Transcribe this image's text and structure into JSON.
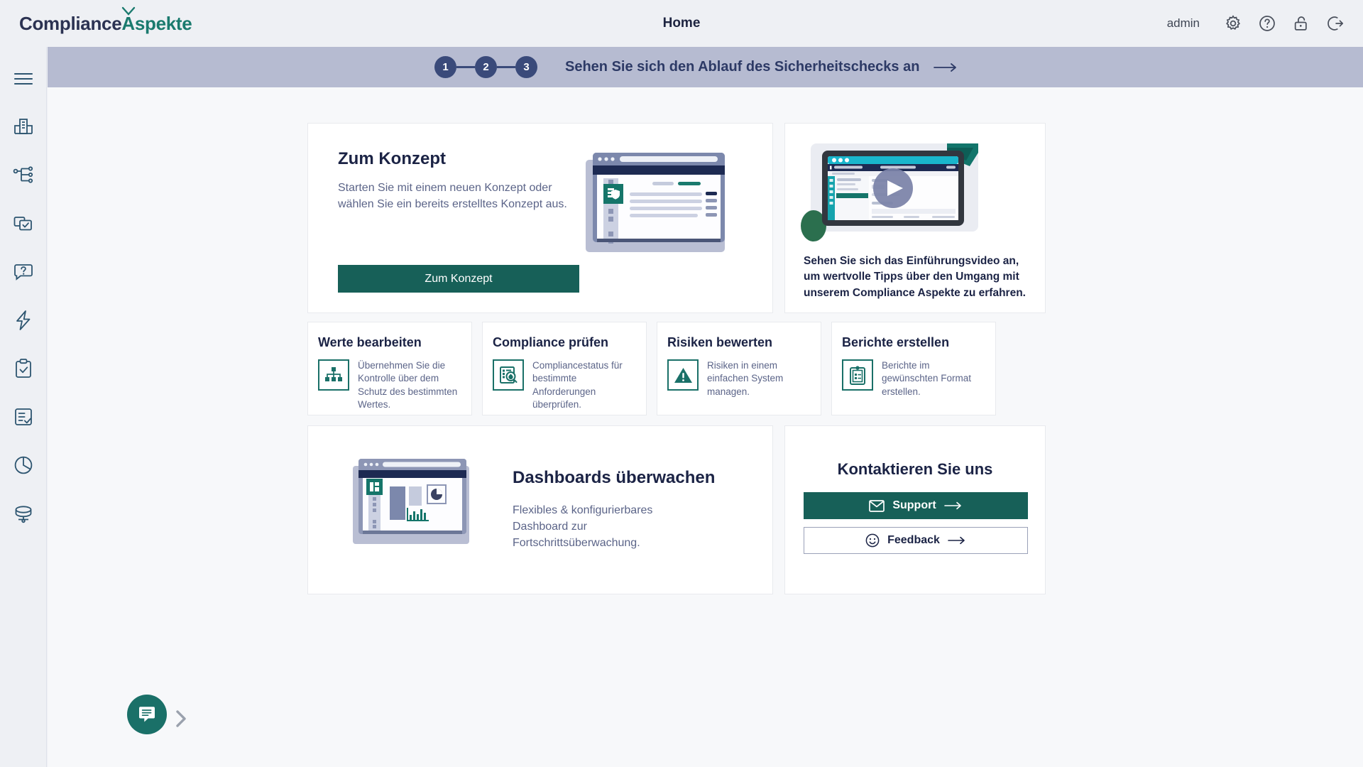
{
  "brand": {
    "name_part1": "Compliance",
    "name_part2": "Aspekte",
    "check_icon": "check-icon",
    "teal": "#1a7a6e",
    "navy": "#2b3252"
  },
  "header": {
    "title": "Home",
    "username": "admin",
    "icons": [
      {
        "name": "gear-icon",
        "label": "Einstellungen"
      },
      {
        "name": "help-circle-icon",
        "label": "Hilfe"
      },
      {
        "name": "unlock-icon",
        "label": "Passwort"
      },
      {
        "name": "logout-icon",
        "label": "Abmelden"
      }
    ]
  },
  "sidebar": {
    "items": [
      {
        "name": "hamburger-menu-icon",
        "label": "Menü"
      },
      {
        "name": "organization-icon",
        "label": "Organisation"
      },
      {
        "name": "hierarchy-icon",
        "label": "Struktur"
      },
      {
        "name": "documents-check-icon",
        "label": "Dokumente"
      },
      {
        "name": "question-bubble-icon",
        "label": "Fragen"
      },
      {
        "name": "lightning-icon",
        "label": "Aktionen"
      },
      {
        "name": "clipboard-check-icon",
        "label": "Aufgaben"
      },
      {
        "name": "document-check-icon",
        "label": "Berichte"
      },
      {
        "name": "pie-chart-icon",
        "label": "Auswertungen"
      },
      {
        "name": "database-icon",
        "label": "Daten"
      }
    ]
  },
  "banner": {
    "steps": [
      "1",
      "2",
      "3"
    ],
    "text": "Sehen Sie sich den Ablauf des Sicherheitschecks an",
    "arrow_icon": "arrow-right-icon",
    "background": "#b6bbd1",
    "text_color": "#2d3a66"
  },
  "konzept_card": {
    "title": "Zum Konzept",
    "body": "Starten Sie mit einem neuen Konzept oder wählen Sie ein bereits erstelltes Konzept aus.",
    "button_label": "Zum Konzept",
    "illustration": "browser-window-shield-illustration"
  },
  "video_card": {
    "thumbnail": "intro-video-thumbnail",
    "play_icon": "play-button-icon",
    "text": "Sehen Sie sich das Einführungsvideo an, um wertvolle Tipps über den Umgang mit unserem Compliance Aspekte zu erfahren."
  },
  "features": [
    {
      "title": "Werte bearbeiten",
      "text": "Übernehmen Sie die Kontrolle über dem Schutz des bestimmten Wertes.",
      "icon": "hierarchy-nodes-icon"
    },
    {
      "title": "Compliance prüfen",
      "text": "Compliancestatus für bestimmte Anforderungen überprüfen.",
      "icon": "document-magnifier-icon"
    },
    {
      "title": "Risiken bewerten",
      "text": "Risiken in einem einfachen System managen.",
      "icon": "warning-triangle-icon"
    },
    {
      "title": "Berichte erstellen",
      "text": "Berichte im gewünschten Format erstellen.",
      "icon": "clipboard-report-icon"
    }
  ],
  "dashboard_card": {
    "title": "Dashboards überwachen",
    "body": "Flexibles & konfigurierbares Dashboard zur Fortschrittsüberwachung.",
    "illustration": "dashboard-browser-illustration"
  },
  "contact_card": {
    "title": "Kontaktieren Sie uns",
    "support_label": "Support",
    "support_icon": "envelope-icon",
    "feedback_label": "Feedback",
    "feedback_icon": "smiley-icon",
    "arrow_icon": "arrow-right-icon"
  },
  "chat_widget": {
    "icon": "chat-bubble-icon",
    "chevron_icon": "chevron-right-icon",
    "color": "#1a7068"
  }
}
